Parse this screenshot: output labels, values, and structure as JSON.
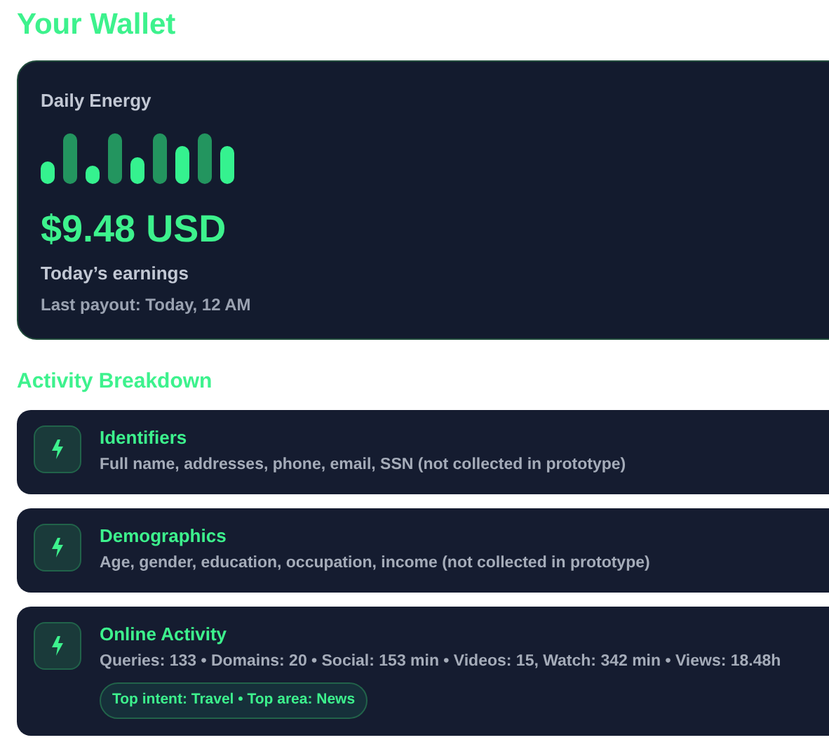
{
  "title": "Your Wallet",
  "wallet": {
    "label": "Daily Energy",
    "amount": "$9.48 USD",
    "caption": "Today’s earnings",
    "last_payout": "Last payout: Today, 12 AM"
  },
  "section_title": "Activity Breakdown",
  "categories": [
    {
      "name": "Identifiers",
      "description": "Full name, addresses, phone, email, SSN (not collected in prototype)"
    },
    {
      "name": "Demographics",
      "description": "Age, gender, education, occupation, income (not collected in prototype)"
    },
    {
      "name": "Online Activity",
      "description": "Queries: 133 • Domains: 20 • Social: 153 min • Videos: 15, Watch: 342 min • Views: 18.48h",
      "tag": "Top intent: Travel • Top area: News"
    }
  ]
}
